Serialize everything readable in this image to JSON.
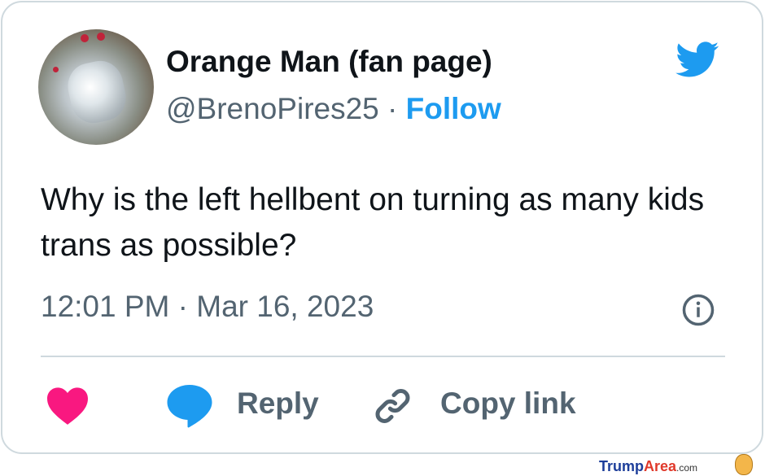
{
  "tweet": {
    "display_name": "Orange Man (fan page)",
    "handle": "@BrenoPires25",
    "separator": "·",
    "follow_label": "Follow",
    "text": "Why is the left hellbent on turning as many kids trans as possible?",
    "timestamp": "12:01 PM · Mar 16, 2023"
  },
  "actions": {
    "like_icon": "heart-icon",
    "reply_icon": "speech-bubble-icon",
    "reply_label": "Reply",
    "copy_icon": "link-icon",
    "copy_label": "Copy link"
  },
  "icons": {
    "brand": "twitter-bird-icon",
    "info": "info-icon"
  },
  "colors": {
    "brand_blue": "#1d9bf0",
    "like_pink": "#f91880",
    "text_primary": "#0f1419",
    "text_secondary": "#536471",
    "border": "#cfd9de"
  },
  "watermark": {
    "brand_part1": "Trump",
    "brand_part2": "Area",
    "brand_tld": ".com"
  }
}
